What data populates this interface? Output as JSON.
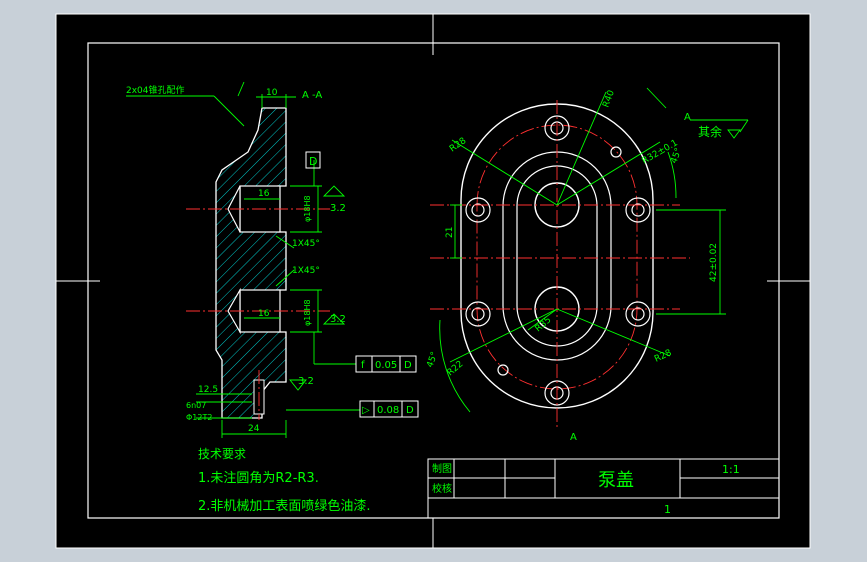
{
  "drawing": {
    "section_label": "A -A",
    "view_label_right": "A",
    "surface_note": "其余",
    "roughness_other": "",
    "part_name": "泵盖",
    "scale": "1:1",
    "sheet_count": "1",
    "title_block": {
      "drawn_label": "制图",
      "checked_label": "校核"
    },
    "tech_requirements": {
      "heading": "技术要求",
      "items": [
        "1.未注圆角为R2-R3.",
        "2.非机械加工表面喷绿色油漆."
      ]
    },
    "dimensions_left": {
      "thread_callout": "2x04锥孔配作",
      "top_width": "10",
      "bore_depth_top": "16",
      "bore_depth_bottom": "16",
      "bore_dia_top": "φ18H8",
      "bore_dia_bottom": "φ18H8",
      "chamfer_top": "1X45°",
      "chamfer_bottom": "1X45°",
      "roughness_top": "3.2",
      "roughness_mid": "3.2",
      "roughness_bottom": "3.2",
      "datum": "D",
      "tol1_symbol": "f",
      "tol1_value": "0.05",
      "tol1_datum": "D",
      "tol2_symbol": "▷",
      "tol2_value": "0.08",
      "tol2_datum": "D",
      "dim_12_5": "12.5",
      "dim_6": "6n07",
      "dim_thread": "Φ12T2",
      "overall_width": "24"
    },
    "dimensions_right": {
      "r1": "R28",
      "r2": "R40",
      "r3": "R32±0.1",
      "r4": "R28",
      "r5": "R35",
      "angle1": "45°",
      "angle2": "45°",
      "dim_21": "21",
      "dim_center": "42±0.02",
      "r6": "R22"
    }
  }
}
